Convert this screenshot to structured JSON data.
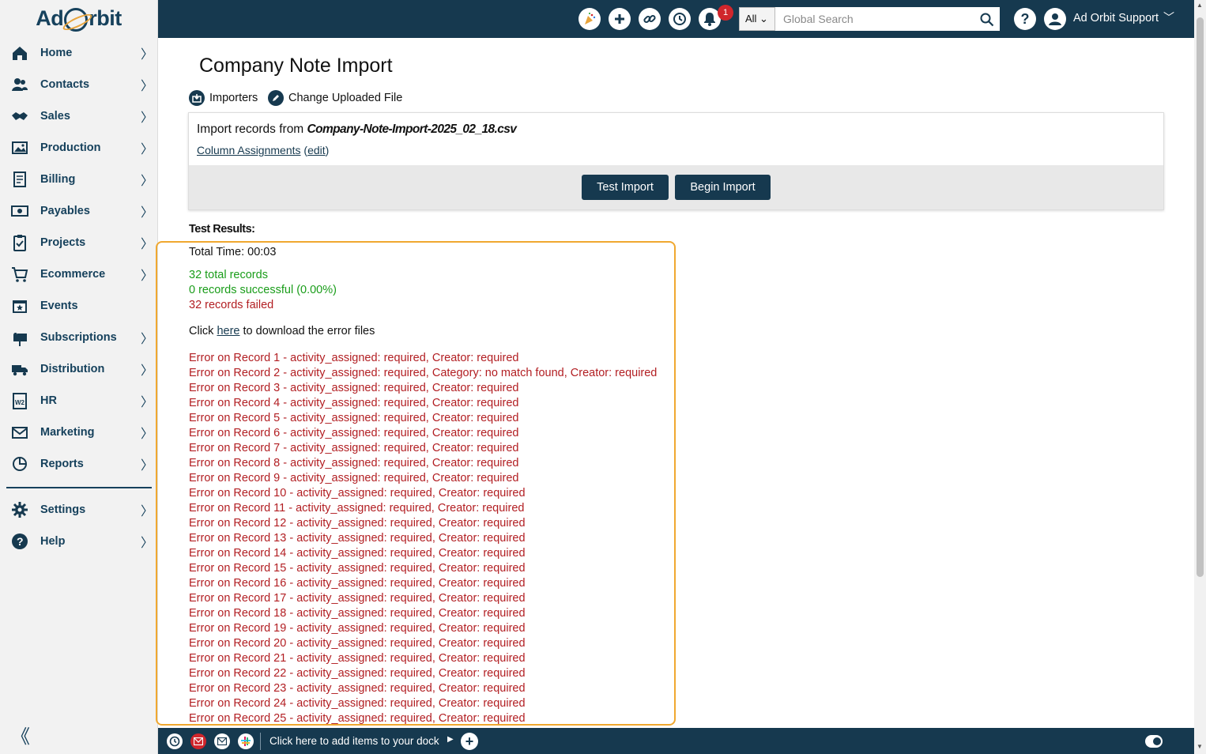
{
  "logo": {
    "text_before": "Ad",
    "text_after": "rbit"
  },
  "sidebar": {
    "items": [
      {
        "label": "Home",
        "icon": "home-icon",
        "chevron": "〉"
      },
      {
        "label": "Contacts",
        "icon": "contacts-icon",
        "chevron": "〉"
      },
      {
        "label": "Sales",
        "icon": "handshake-icon",
        "chevron": "〉"
      },
      {
        "label": "Production",
        "icon": "image-icon",
        "chevron": "〉"
      },
      {
        "label": "Billing",
        "icon": "invoice-icon",
        "chevron": "〉"
      },
      {
        "label": "Payables",
        "icon": "money-icon",
        "chevron": "〉"
      },
      {
        "label": "Projects",
        "icon": "clipboard-icon",
        "chevron": "〉"
      },
      {
        "label": "Ecommerce",
        "icon": "cart-icon",
        "chevron": "〉"
      },
      {
        "label": "Events",
        "icon": "calendar-icon",
        "chevron": ""
      },
      {
        "label": "Subscriptions",
        "icon": "mailbox-icon",
        "chevron": "〉"
      },
      {
        "label": "Distribution",
        "icon": "truck-icon",
        "chevron": "〉"
      },
      {
        "label": "HR",
        "icon": "w2-icon",
        "chevron": "〉"
      },
      {
        "label": "Marketing",
        "icon": "envelope-icon",
        "chevron": "〉"
      },
      {
        "label": "Reports",
        "icon": "chart-icon",
        "chevron": "〉"
      },
      {
        "label": "Settings",
        "icon": "gear-icon",
        "chevron": "〉"
      },
      {
        "label": "Help",
        "icon": "help-icon",
        "chevron": "〉"
      }
    ],
    "collapse": "《"
  },
  "topbar": {
    "notification_count": "1",
    "search_scope": "All ⌄",
    "search_placeholder": "Global Search",
    "user_name": "Ad Orbit Support",
    "user_caret": "﹀",
    "help": "?"
  },
  "main": {
    "title": "Company Note Import",
    "actions": {
      "importers": "Importers",
      "change_file": "Change Uploaded File"
    },
    "import_prefix": "Import records from ",
    "file_name": "Company-Note-Import-2025_02_18.csv",
    "column_assignments": "Column Assignments",
    "edit_open": " (",
    "edit": "edit",
    "edit_close": ")",
    "buttons": {
      "test": "Test Import",
      "begin": "Begin Import"
    },
    "test_results_label": "Test Results:",
    "total_time": "Total Time: 00:03",
    "total_records": "32 total records",
    "successful": "0 records successful (0.00%)",
    "failed": "32 records failed",
    "download_prefix": "Click ",
    "download_link": "here",
    "download_suffix": " to download the error files",
    "errors": [
      "Error on Record 1 - activity_assigned: required, Creator: required",
      "Error on Record 2 - activity_assigned: required, Category: no match found, Creator: required",
      "Error on Record 3 - activity_assigned: required, Creator: required",
      "Error on Record 4 - activity_assigned: required, Creator: required",
      "Error on Record 5 - activity_assigned: required, Creator: required",
      "Error on Record 6 - activity_assigned: required, Creator: required",
      "Error on Record 7 - activity_assigned: required, Creator: required",
      "Error on Record 8 - activity_assigned: required, Creator: required",
      "Error on Record 9 - activity_assigned: required, Creator: required",
      "Error on Record 10 - activity_assigned: required, Creator: required",
      "Error on Record 11 - activity_assigned: required, Creator: required",
      "Error on Record 12 - activity_assigned: required, Creator: required",
      "Error on Record 13 - activity_assigned: required, Creator: required",
      "Error on Record 14 - activity_assigned: required, Creator: required",
      "Error on Record 15 - activity_assigned: required, Creator: required",
      "Error on Record 16 - activity_assigned: required, Creator: required",
      "Error on Record 17 - activity_assigned: required, Creator: required",
      "Error on Record 18 - activity_assigned: required, Creator: required",
      "Error on Record 19 - activity_assigned: required, Creator: required",
      "Error on Record 20 - activity_assigned: required, Creator: required",
      "Error on Record 21 - activity_assigned: required, Creator: required",
      "Error on Record 22 - activity_assigned: required, Creator: required",
      "Error on Record 23 - activity_assigned: required, Creator: required",
      "Error on Record 24 - activity_assigned: required, Creator: required",
      "Error on Record 25 - activity_assigned: required, Creator: required"
    ]
  },
  "dock": {
    "text": "Click here to add items to your dock"
  },
  "colors": {
    "navy": "#16394f",
    "success": "#1a9d1a",
    "error": "#b21e22",
    "highlight": "#f0a830"
  }
}
